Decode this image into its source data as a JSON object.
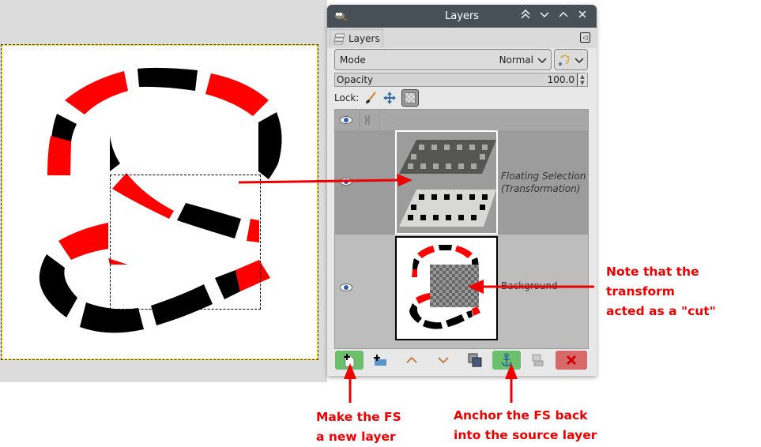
{
  "canvas": {
    "description": "GIMP image canvas with dashed red/black S-shaped path and a floating selection region"
  },
  "dialog": {
    "title": "Layers",
    "titlebar_buttons": [
      "shade-up",
      "minimize",
      "maximize",
      "close"
    ],
    "tab_label": "Layers",
    "mode_label": "Mode",
    "mode_value": "Normal",
    "opacity_label": "Opacity",
    "opacity_value": "100.0",
    "lock_label": "Lock:",
    "layers": [
      {
        "name_line1": "Floating Selection",
        "name_line2": "(Transformation)",
        "visible": true,
        "selected": true
      },
      {
        "name": "Background",
        "visible": true,
        "selected": false
      }
    ],
    "bottom_buttons": [
      "new-layer",
      "new-layer-group",
      "raise-layer",
      "lower-layer",
      "duplicate-layer",
      "anchor-layer",
      "merge-down",
      "delete-layer"
    ]
  },
  "annotations": {
    "new_layer_note": "Make the FS\na new layer",
    "anchor_note": "Anchor the FS back\ninto the source layer",
    "cut_note": "Note that the\ntransform\nacted as a \"cut\"",
    "color": "#ee0000"
  }
}
